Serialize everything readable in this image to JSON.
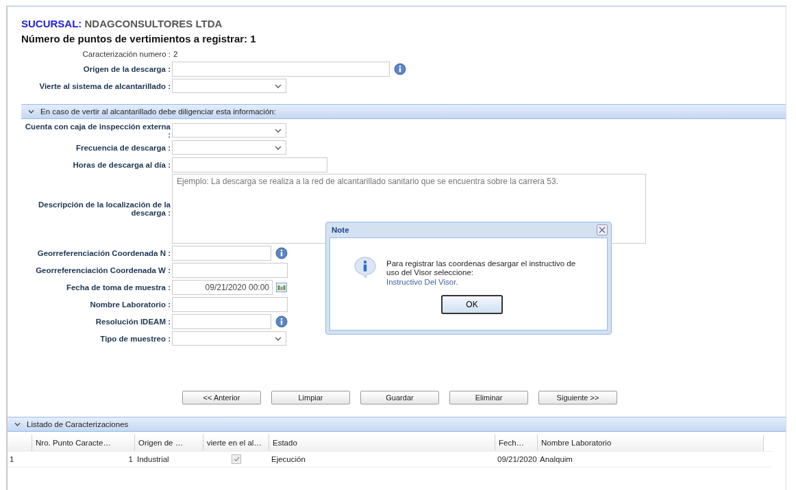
{
  "sucursal": {
    "label": "SUCURSAL:",
    "value": "NDAGCONSULTORES LTDA"
  },
  "heading": "Número de puntos de vertimientos a registrar: 1",
  "caracterizacion": {
    "label": "Caracterización numero :",
    "value": "2"
  },
  "top_fields": [
    {
      "label": "Origen de la descarga :",
      "kind": "text",
      "info": true
    },
    {
      "label": "Vierte al sistema de alcantarillado :",
      "kind": "select",
      "info": false
    }
  ],
  "section": {
    "title": "En caso de vertir al alcantarillado debe diligenciar esta información:",
    "expanded": true
  },
  "section_fields": [
    {
      "label": "Cuenta con caja de inspección externa :",
      "kind": "select",
      "info": false
    },
    {
      "label": "Frecuencia de descarga :",
      "kind": "select",
      "info": false
    },
    {
      "label": "Horas de descarga al día :",
      "kind": "text",
      "info": false
    },
    {
      "label": "Descripción de la localización de la descarga :",
      "kind": "textarea",
      "info": false,
      "placeholder": "Ejemplo: La descarga se realiza a la red de alcantarillado sanitario que se encuentra sobre la carrera 53."
    },
    {
      "label": "Georreferenciación Coordenada N :",
      "kind": "text",
      "info": true
    },
    {
      "label": "Georreferenciación Coordenada W :",
      "kind": "text",
      "info": false
    },
    {
      "label": "Fecha de toma de muestra :",
      "kind": "date",
      "info": false,
      "value": "09/21/2020 00:00"
    },
    {
      "label": "Nombre Laboratorio :",
      "kind": "text",
      "info": false
    },
    {
      "label": "Resolución IDEAM :",
      "kind": "text",
      "info": true
    },
    {
      "label": "Tipo de muestreo :",
      "kind": "select",
      "info": false
    }
  ],
  "buttons": [
    "<< Anterior",
    "Limpiar",
    "Guardar",
    "Eliminar",
    "Siguiente >>"
  ],
  "listing": {
    "title": "Listado de Caracterizaciones",
    "expanded": true,
    "columns": [
      "Nro. Punto Caracte…",
      "Origen de …",
      "vierte en el al…",
      "Estado",
      "Fech…",
      "Nombre Laboratorio"
    ],
    "rows": [
      {
        "index": "1",
        "punto": "1",
        "origen": "Industrial",
        "vierte": true,
        "estado": "Ejecución",
        "fecha": "09/21/2020",
        "laboratorio": "Analquim"
      }
    ]
  },
  "dialog": {
    "title": "Note",
    "message": "Para registrar las coordenas desargar el instructivo de uso del Visor seleccione:",
    "link": "Instructivo Del Visor.",
    "button": "OK"
  }
}
